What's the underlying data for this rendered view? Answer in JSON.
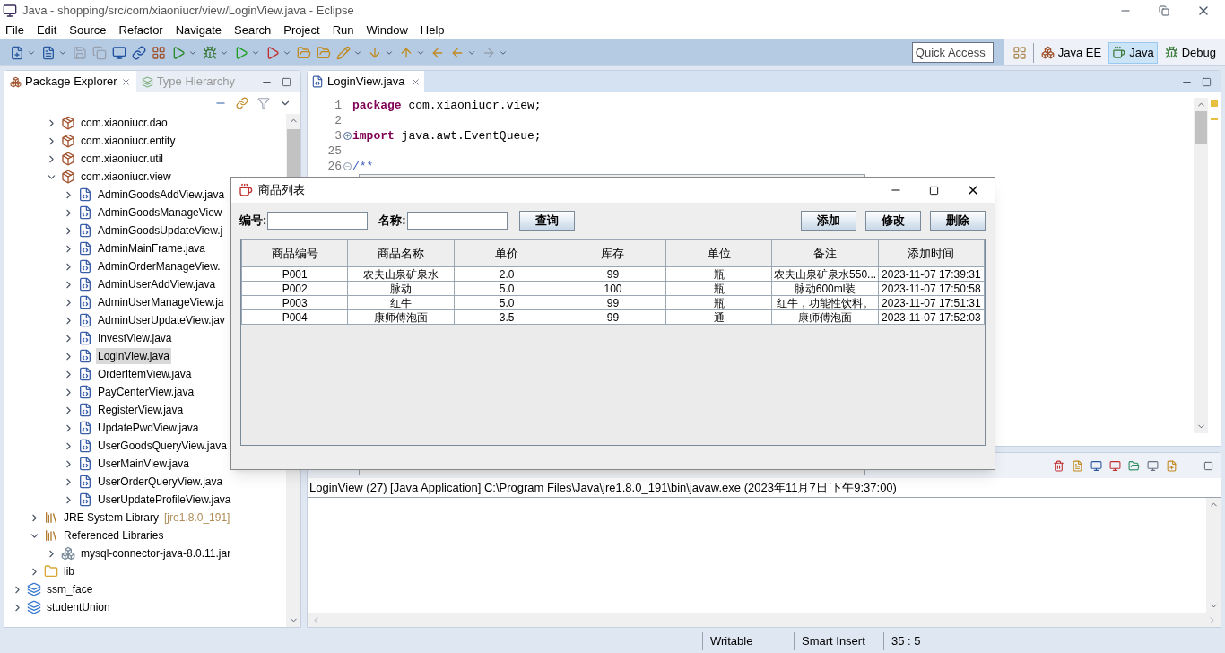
{
  "window": {
    "title": "Java - shopping/src/com/xiaoniucr/view/LoginView.java - Eclipse"
  },
  "menu": [
    "File",
    "Edit",
    "Source",
    "Refactor",
    "Navigate",
    "Search",
    "Project",
    "Run",
    "Window",
    "Help"
  ],
  "toolbar": {
    "quick_access": {
      "placeholder": "Quick Access"
    },
    "perspectives": [
      {
        "label": "Java EE",
        "selected": false
      },
      {
        "label": "Java",
        "selected": true
      },
      {
        "label": "Debug",
        "selected": false
      }
    ]
  },
  "package_explorer": {
    "tabs": [
      {
        "label": "Package Explorer",
        "selected": true
      },
      {
        "label": "Type Hierarchy",
        "selected": false
      }
    ],
    "tree": [
      {
        "children": [
          {
            "children": [
              {
                "label": "com.xiaoniucr.dao",
                "kind": "package",
                "expanded": false,
                "selected": false
              },
              {
                "label": "com.xiaoniucr.entity",
                "kind": "package",
                "expanded": false,
                "selected": false
              },
              {
                "label": "com.xiaoniucr.util",
                "kind": "package",
                "expanded": false,
                "selected": false
              },
              {
                "label": "com.xiaoniucr.view",
                "kind": "package",
                "expanded": true,
                "selected": false,
                "children": [
                  {
                    "label": "AdminGoodsAddView.java",
                    "kind": "java",
                    "expanded": false,
                    "selected": false
                  },
                  {
                    "label": "AdminGoodsManageView",
                    "kind": "java",
                    "expanded": false,
                    "selected": false
                  },
                  {
                    "label": "AdminGoodsUpdateView.j",
                    "kind": "java",
                    "expanded": false,
                    "selected": false
                  },
                  {
                    "label": "AdminMainFrame.java",
                    "kind": "java",
                    "expanded": false,
                    "selected": false
                  },
                  {
                    "label": "AdminOrderManageView.",
                    "kind": "java",
                    "expanded": false,
                    "selected": false
                  },
                  {
                    "label": "AdminUserAddView.java",
                    "kind": "java",
                    "expanded": false,
                    "selected": false
                  },
                  {
                    "label": "AdminUserManageView.ja",
                    "kind": "java",
                    "expanded": false,
                    "selected": false
                  },
                  {
                    "label": "AdminUserUpdateView.jav",
                    "kind": "java",
                    "expanded": false,
                    "selected": false
                  },
                  {
                    "label": "InvestView.java",
                    "kind": "java",
                    "expanded": false,
                    "selected": false
                  },
                  {
                    "label": "LoginView.java",
                    "kind": "java",
                    "expanded": false,
                    "selected": true
                  },
                  {
                    "label": "OrderItemView.java",
                    "kind": "java",
                    "expanded": false,
                    "selected": false
                  },
                  {
                    "label": "PayCenterView.java",
                    "kind": "java",
                    "expanded": false,
                    "selected": false
                  },
                  {
                    "label": "RegisterView.java",
                    "kind": "java",
                    "expanded": false,
                    "selected": false
                  },
                  {
                    "label": "UpdatePwdView.java",
                    "kind": "java",
                    "expanded": false,
                    "selected": false
                  },
                  {
                    "label": "UserGoodsQueryView.java",
                    "kind": "java",
                    "expanded": false,
                    "selected": false
                  },
                  {
                    "label": "UserMainView.java",
                    "kind": "java",
                    "expanded": false,
                    "selected": false
                  },
                  {
                    "label": "UserOrderQueryView.java",
                    "kind": "java",
                    "expanded": false,
                    "selected": false
                  },
                  {
                    "label": "UserUpdateProfileView.java",
                    "kind": "java",
                    "expanded": false,
                    "selected": false
                  }
                ]
              }
            ]
          },
          {
            "label": "JRE System Library",
            "decoration": "[jre1.8.0_191]",
            "kind": "library",
            "expanded": false,
            "selected": false
          },
          {
            "label": "Referenced Libraries",
            "kind": "library",
            "expanded": true,
            "selected": false,
            "children": [
              {
                "label": "mysql-connector-java-8.0.11.jar",
                "kind": "jar",
                "expanded": false,
                "selected": false
              }
            ]
          },
          {
            "label": "lib",
            "kind": "folder",
            "expanded": false,
            "selected": false
          }
        ]
      },
      {
        "label": "ssm_face",
        "kind": "project",
        "expanded": false,
        "selected": false
      },
      {
        "label": "studentUnion",
        "kind": "project",
        "expanded": false,
        "selected": false
      }
    ]
  },
  "editor": {
    "tabs": [
      {
        "label": "LoginView.java",
        "selected": true
      }
    ],
    "lines": [
      {
        "number": "1",
        "tokens": [
          {
            "text": "package",
            "kind": "keyword"
          },
          {
            "text": " com.xiaoniucr.view;",
            "kind": "plain"
          }
        ]
      },
      {
        "number": "2"
      },
      {
        "number": "3",
        "collapsed": true,
        "tokens": [
          {
            "text": "import",
            "kind": "keyword"
          },
          {
            "text": " java.awt.EventQueue;",
            "kind": "plain"
          }
        ]
      },
      {
        "number": "25"
      },
      {
        "number": "26",
        "collapsed": false,
        "tokens": [
          {
            "text": "/**",
            "kind": "comment"
          }
        ]
      }
    ]
  },
  "console": {
    "header": "LoginView (27) [Java Application] C:\\Program Files\\Java\\jre1.8.0_191\\bin\\javaw.exe (2023年11月7日 下午9:37:00)"
  },
  "status_bar": [
    "Writable",
    "Smart Insert",
    "35 : 5"
  ],
  "dialog": {
    "title": "商品列表",
    "search": [
      {
        "label": "编号:"
      },
      {
        "label": "名称:"
      }
    ],
    "query_button": "查询",
    "actions": [
      "添加",
      "修改",
      "删除"
    ],
    "table": {
      "columns": [
        "商品编号",
        "商品名称",
        "单价",
        "库存",
        "单位",
        "备注",
        "添加时间"
      ],
      "rows": [
        [
          "P001",
          "农夫山泉矿泉水",
          "2.0",
          "99",
          "瓶",
          "农夫山泉矿泉水550...",
          "2023-11-07 17:39:31"
        ],
        [
          "P002",
          "脉动",
          "5.0",
          "100",
          "瓶",
          "脉动600ml装",
          "2023-11-07 17:50:58"
        ],
        [
          "P003",
          "红牛",
          "5.0",
          "99",
          "瓶",
          "红牛，功能性饮料。",
          "2023-11-07 17:51:31"
        ],
        [
          "P004",
          "康师傅泡面",
          "3.5",
          "99",
          "通",
          "康师傅泡面",
          "2023-11-07 17:52:03"
        ]
      ]
    }
  }
}
